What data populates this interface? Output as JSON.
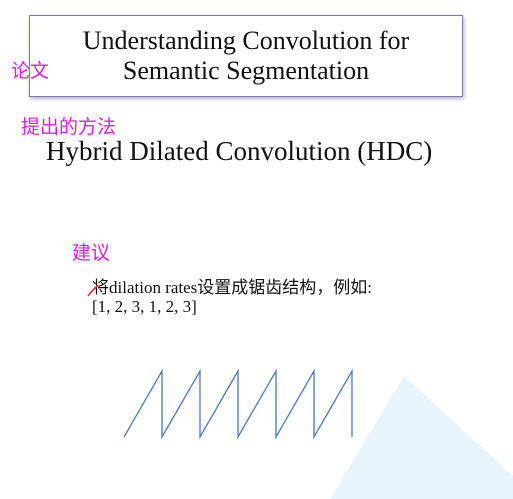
{
  "slide": {
    "title_line1": "Understanding Convolution for",
    "title_line2": "Semantic Segmentation",
    "method": "Hybrid Dilated Convolution (HDC)",
    "suggestion_text": "将dilation rates设置成锯齿结构，例如:",
    "rates_example": "[1, 2, 3, 1, 2, 3]"
  },
  "annotations": {
    "paper": "论文",
    "proposed_method": "提出的方法",
    "suggestion": "建议"
  },
  "colors": {
    "annotation": "#e020e0",
    "box_border": "#7e7aa8",
    "sawtooth": "#4a7ab8",
    "triangle": "#e8f4fc",
    "check_mark": "#e03030"
  }
}
